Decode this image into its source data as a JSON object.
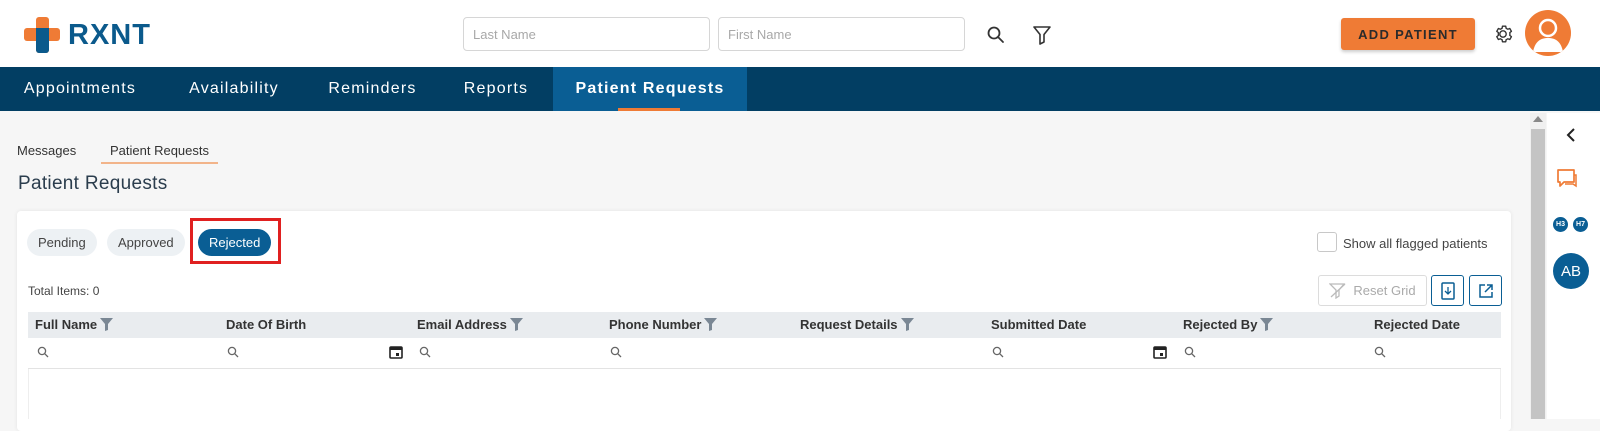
{
  "brand": {
    "name": "RXNT"
  },
  "header": {
    "last_name_placeholder": "Last Name",
    "first_name_placeholder": "First Name",
    "add_patient_label": "ADD PATIENT",
    "search_icon": "search-icon",
    "filter_icon": "filter-icon",
    "settings_icon": "gear-icon"
  },
  "nav": {
    "items": [
      {
        "label": "Appointments"
      },
      {
        "label": "Availability"
      },
      {
        "label": "Reminders"
      },
      {
        "label": "Reports"
      },
      {
        "label": "Patient Requests",
        "active": true
      }
    ]
  },
  "subtabs": [
    {
      "label": "Messages"
    },
    {
      "label": "Patient Requests",
      "active": true
    }
  ],
  "page": {
    "title": "Patient Requests"
  },
  "status_filters": [
    {
      "label": "Pending"
    },
    {
      "label": "Approved"
    },
    {
      "label": "Rejected",
      "active": true
    }
  ],
  "flagged": {
    "label": "Show all flagged patients",
    "checked": false
  },
  "grid": {
    "total_items": "Total Items: 0",
    "reset_label": "Reset Grid",
    "columns": [
      {
        "label": "Full Name",
        "filter": true
      },
      {
        "label": "Date Of Birth",
        "filter": false
      },
      {
        "label": "Email Address",
        "filter": true
      },
      {
        "label": "Phone Number",
        "filter": true
      },
      {
        "label": "Request Details",
        "filter": true
      },
      {
        "label": "Submitted Date",
        "filter": false
      },
      {
        "label": "Rejected By",
        "filter": true
      },
      {
        "label": "Rejected Date",
        "filter": false
      }
    ]
  },
  "right_panel": {
    "badges": [
      "H3",
      "H7"
    ],
    "user_initials": "AB"
  },
  "colors": {
    "accent": "#ef7b35",
    "brand_blue": "#0a5e94",
    "nav_bg": "#023e63",
    "highlight": "#e02020"
  }
}
